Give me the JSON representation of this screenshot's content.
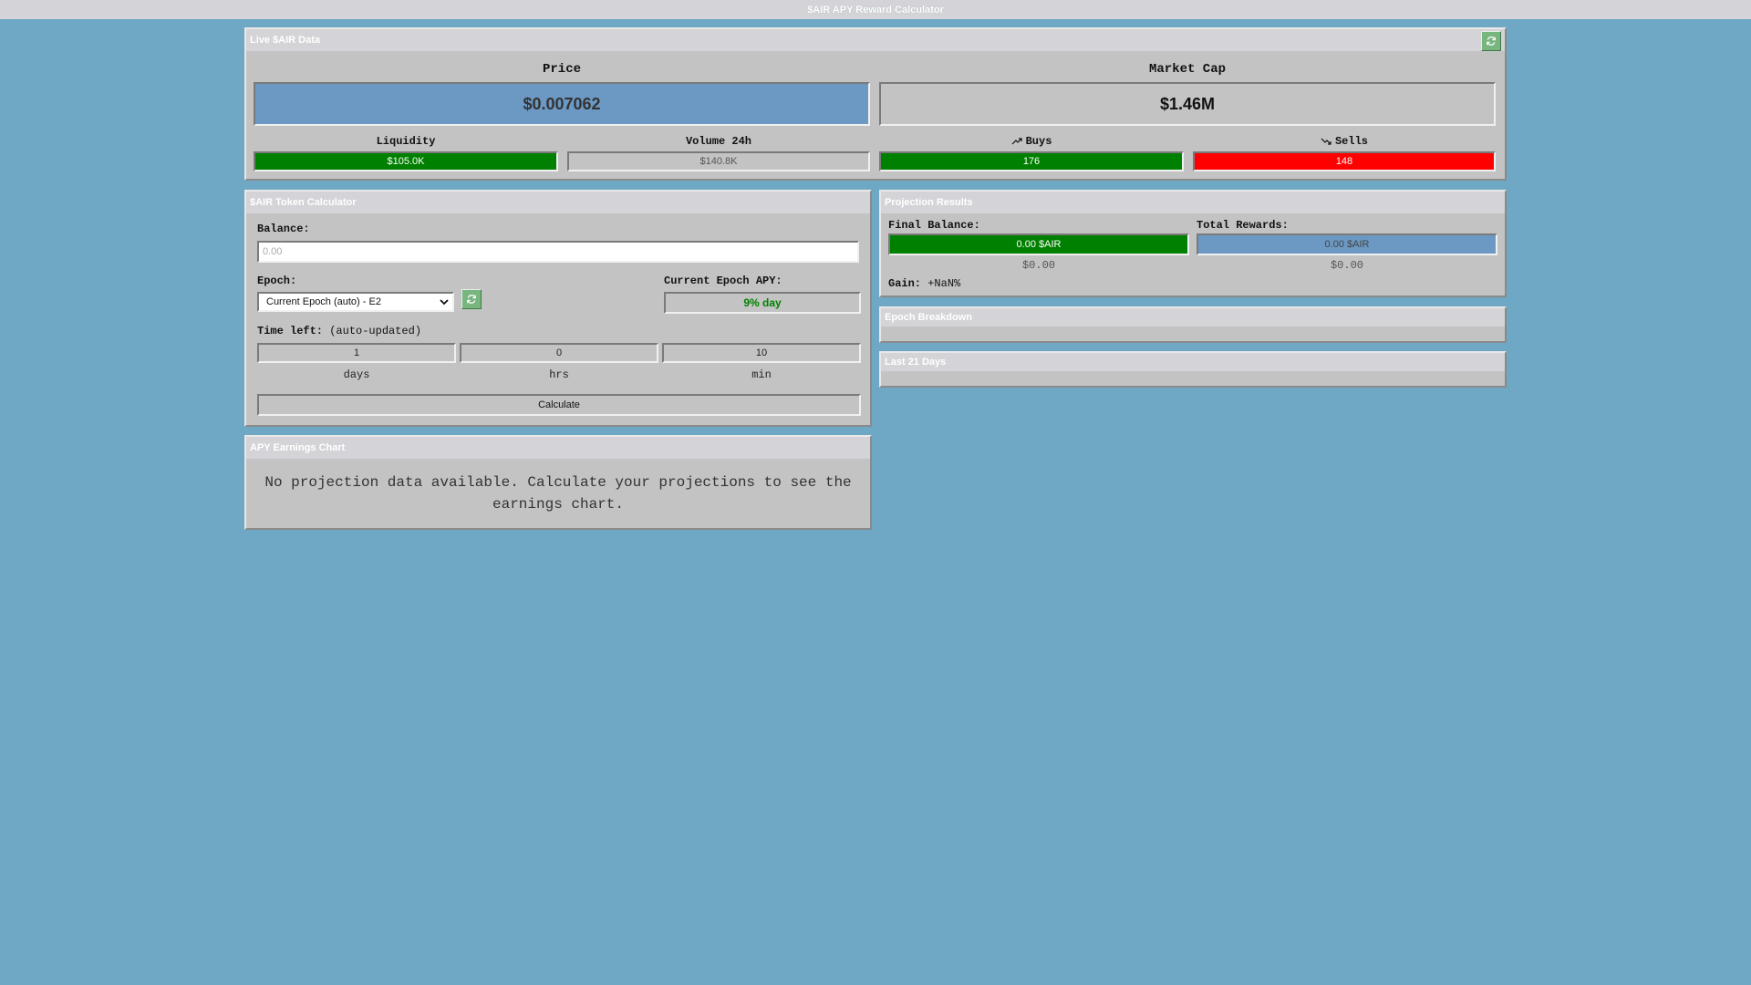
{
  "app": {
    "title": "$AIR APY Reward Calculator"
  },
  "live": {
    "header": "Live $AIR Data",
    "refresh_icon": "refresh-icon",
    "price_label": "Price",
    "price_value": "$0.007062",
    "marketcap_label": "Market Cap",
    "marketcap_value": "$1.46M",
    "liquidity_label": "Liquidity",
    "liquidity_value": "$105.0K",
    "volume_label": "Volume 24h",
    "volume_value": "$140.8K",
    "buys_label": "Buys",
    "buys_icon": "trend-up-icon",
    "buys_value": "176",
    "sells_label": "Sells",
    "sells_icon": "trend-down-icon",
    "sells_value": "148",
    "colors": {
      "green": "#008000",
      "red": "#ff0000",
      "blue": "#6b99c4"
    }
  },
  "calculator": {
    "header": "$AIR Token Calculator",
    "balance_label": "Balance:",
    "balance_placeholder": "0.00",
    "epoch_label": "Epoch:",
    "epoch_selected": "Current Epoch (auto) - E2",
    "apy_label": "Current Epoch APY:",
    "apy_value": "9% day",
    "time_left_label": "Time left:",
    "time_left_note": "(auto-updated)",
    "days_value": "1",
    "hrs_value": "0",
    "min_value": "10",
    "days_unit": "days",
    "hrs_unit": "hrs",
    "min_unit": "min",
    "calculate_label": "Calculate"
  },
  "chart_panel": {
    "header": "APY Earnings Chart",
    "empty_message": "No projection data available. Calculate your projections to see the earnings chart."
  },
  "projection": {
    "header": "Projection Results",
    "final_balance_label": "Final Balance:",
    "final_balance_value": "0.00 $AIR",
    "final_balance_usd": "$0.00",
    "total_rewards_label": "Total Rewards:",
    "total_rewards_value": "0.00 $AIR",
    "total_rewards_usd": "$0.00",
    "gain_label": "Gain:",
    "gain_value": "+NaN%"
  },
  "epoch_breakdown": {
    "header": "Epoch Breakdown"
  },
  "last_days": {
    "header": "Last 21 Days"
  }
}
